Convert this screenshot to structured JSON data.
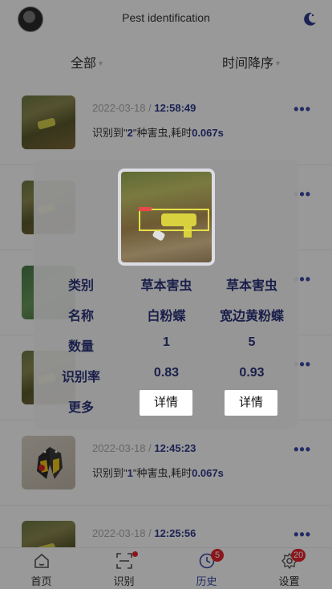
{
  "header": {
    "title": "Pest identification"
  },
  "filters": {
    "category": "全部",
    "sort": "时间降序",
    "caret": "▾"
  },
  "history": [
    {
      "date": "2022-03-18",
      "sep": " / ",
      "time": "12:58:49",
      "pre": "识别到\"",
      "count": "2",
      "mid": "\"种害虫,耗时",
      "duration": "0.067s",
      "thumb": "leaf"
    },
    {
      "date": "",
      "sep": "",
      "time": "",
      "pre": "",
      "count": "",
      "mid": "",
      "duration": "",
      "thumb": "leaf"
    },
    {
      "date": "",
      "sep": "",
      "time": "",
      "pre": "",
      "count": "",
      "mid": "",
      "duration": "",
      "thumb": "green"
    },
    {
      "date": "",
      "sep": "",
      "time": "",
      "pre": "",
      "count": "",
      "mid": "",
      "duration": "",
      "thumb": "leaf"
    },
    {
      "date": "2022-03-18",
      "sep": " / ",
      "time": "12:45:23",
      "pre": "识别到\"",
      "count": "1",
      "mid": "\"种害虫,耗时",
      "duration": "0.067s",
      "thumb": "butterfly"
    },
    {
      "date": "2022-03-18",
      "sep": " / ",
      "time": "12:25:56",
      "pre": "",
      "count": "",
      "mid": "",
      "duration": "",
      "thumb": "leaf"
    }
  ],
  "more_glyph": "•••",
  "modal": {
    "rows": [
      {
        "label": "类别",
        "v1": "草本害虫",
        "v2": "草本害虫"
      },
      {
        "label": "名称",
        "v1": "白粉蝶",
        "v2": "宽边黄粉蝶"
      },
      {
        "label": "数量",
        "v1": "1",
        "v2": "5"
      },
      {
        "label": "识别率",
        "v1": "0.83",
        "v2": "0.93"
      }
    ],
    "more_label": "更多",
    "detail_label": "详情"
  },
  "tabs": [
    {
      "label": "首页",
      "icon": "home-icon",
      "badge": ""
    },
    {
      "label": "识别",
      "icon": "scan-icon",
      "badge": "dot"
    },
    {
      "label": "历史",
      "icon": "clock-icon",
      "badge": "5"
    },
    {
      "label": "设置",
      "icon": "gear-icon",
      "badge": "20"
    }
  ],
  "colors": {
    "accent": "#3b4aa8",
    "badge": "#e8242c",
    "time": "#2d3a8c"
  }
}
